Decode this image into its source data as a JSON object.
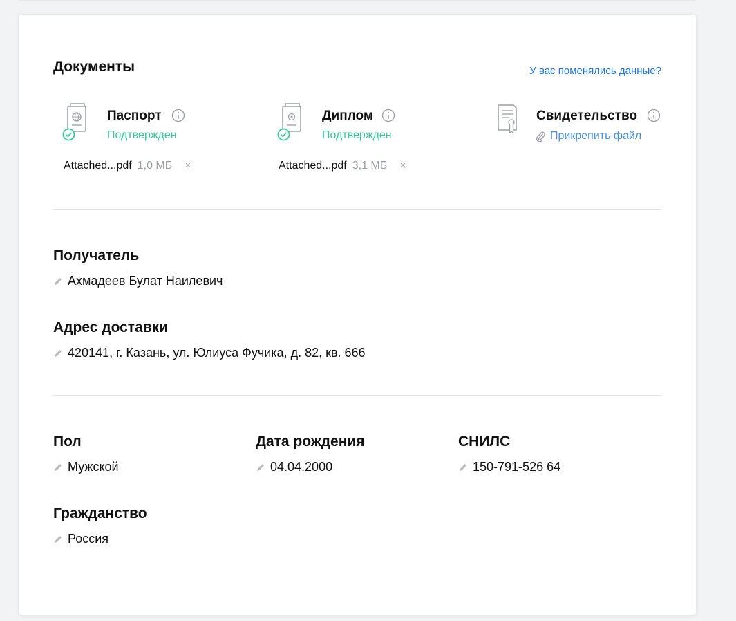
{
  "documents": {
    "title": "Документы",
    "change_link": "У вас поменялись данные?",
    "items": [
      {
        "title": "Паспорт",
        "status": "Подтвержден",
        "file_name": "Attached...pdf",
        "file_size": "1,0 МБ",
        "remove": "×"
      },
      {
        "title": "Диплом",
        "status": "Подтвержден",
        "file_name": "Attached...pdf",
        "file_size": "3,1 МБ",
        "remove": "×"
      },
      {
        "title": "Свидетельство",
        "attach_label": "Прикрепить файл"
      }
    ],
    "colors": {
      "confirmed": "#3cc59a",
      "link": "#1a73e8",
      "attach": "#4a90d9"
    }
  },
  "recipient": {
    "label": "Получатель",
    "value": "Ахмадеев Булат Наилевич"
  },
  "address": {
    "label": "Адрес доставки",
    "value": "420141, г. Казань, ул. Юлиуса Фучика, д. 82, кв. 666"
  },
  "gender": {
    "label": "Пол",
    "value": "Мужской"
  },
  "birth_date": {
    "label": "Дата рождения",
    "value": "04.04.2000"
  },
  "snils": {
    "label": "СНИЛС",
    "value": "150-791-526 64"
  },
  "citizenship": {
    "label": "Гражданство",
    "value": "Россия"
  },
  "icons": {
    "passport": "passport-icon",
    "diploma": "diploma-icon",
    "certificate": "certificate-icon",
    "info": "info-icon",
    "check": "check-circle-icon",
    "paperclip": "paperclip-icon",
    "pencil": "pencil-icon"
  }
}
